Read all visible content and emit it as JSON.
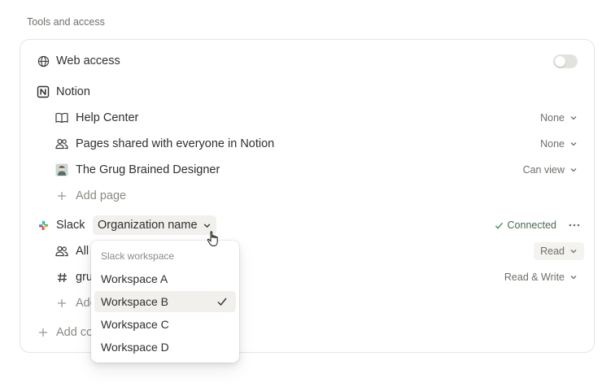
{
  "section": {
    "title": "Tools and access"
  },
  "web_access": {
    "label": "Web access",
    "enabled": false
  },
  "notion": {
    "label": "Notion",
    "pages": [
      {
        "icon": "book-icon",
        "label": "Help Center",
        "permission": "None"
      },
      {
        "icon": "people-icon",
        "label": "Pages shared with everyone in Notion",
        "permission": "None"
      },
      {
        "icon": "avatar-image",
        "label": "The Grug Brained Designer",
        "permission": "Can view"
      }
    ],
    "add_page": "Add page"
  },
  "slack": {
    "label": "Slack",
    "org_name": "Organization name",
    "status": "Connected",
    "channels": [
      {
        "icon": "people-icon",
        "label": "All",
        "permission": "Read"
      },
      {
        "icon": "hash-icon",
        "label": "gru",
        "permission": "Read & Write"
      }
    ],
    "add_channel": "Add"
  },
  "add_connection": "Add co",
  "workspace_dropdown": {
    "heading": "Slack workspace",
    "options": [
      "Workspace A",
      "Workspace B",
      "Workspace C",
      "Workspace D"
    ],
    "selected": "Workspace B"
  },
  "colors": {
    "connected": "#4a8a57",
    "toggle_off": "#e3e2de",
    "selected_bg": "#f1f0ed"
  }
}
